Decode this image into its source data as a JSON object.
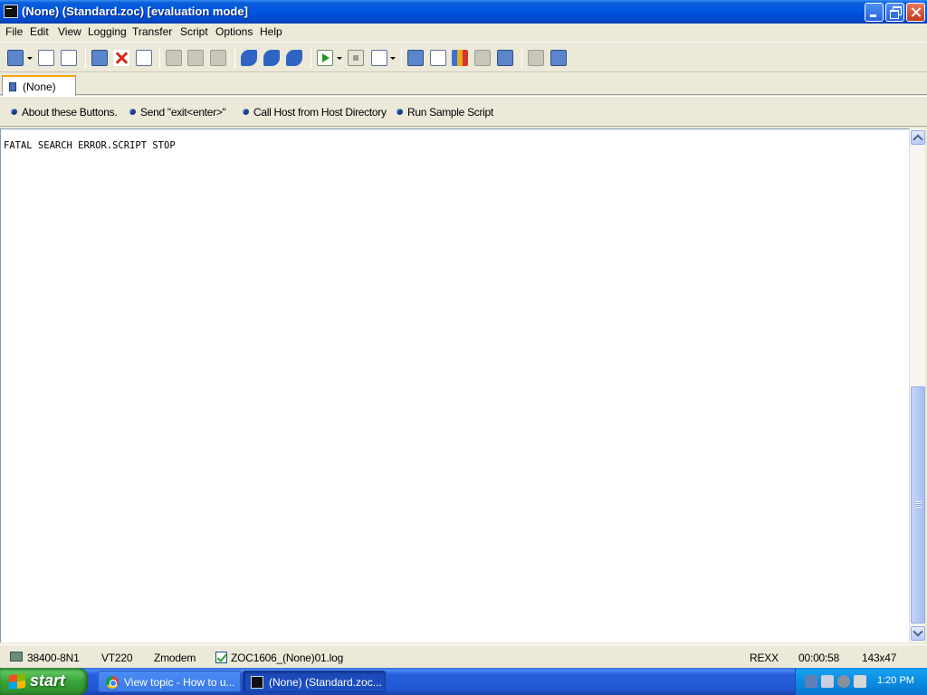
{
  "window": {
    "title": "(None) (Standard.zoc) [evaluation mode]"
  },
  "menu": [
    "File",
    "Edit",
    "View",
    "Logging",
    "Transfer",
    "Script",
    "Options",
    "Help"
  ],
  "tab": {
    "label": "(None)"
  },
  "buttonbar": [
    "About these Buttons.",
    "Send \"exit<enter>\"",
    "Call Host from Host Directory",
    "Run Sample Script"
  ],
  "terminal": {
    "line1": "FATAL SEARCH ERROR.SCRIPT STOP"
  },
  "statusbar": {
    "connection": "38400-8N1",
    "emulation": "VT220",
    "transfer": "Zmodem",
    "logfile": "ZOC1606_(None)01.log",
    "script_lang": "REXX",
    "timer": "00:00:58",
    "size": "143x47"
  },
  "taskbar": {
    "start": "start",
    "tasks": [
      "View topic - How to u...",
      "(None) (Standard.zoc..."
    ],
    "clock": "1:20 PM"
  },
  "colors": {
    "titlebar": "#0054e3",
    "chrome": "#ece9d8",
    "taskbar": "#245edb",
    "start": "#38a538"
  }
}
